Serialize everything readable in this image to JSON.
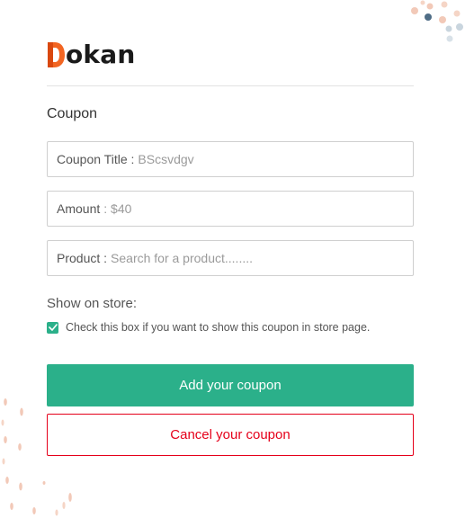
{
  "brand": {
    "letter": "D",
    "name": "okan",
    "accent_color": "#f26522"
  },
  "form": {
    "title": "Coupon",
    "fields": [
      {
        "label": "Coupon Title :",
        "value": "BScsvdgv"
      },
      {
        "label": "Amount",
        "value": ": $40"
      },
      {
        "label": "Product :",
        "value": "Search for a product........"
      }
    ],
    "show_on_store_label": "Show on store:",
    "checkbox_label": "Check this box if you want to show this coupon in store page.",
    "checkbox_checked": true
  },
  "buttons": {
    "add_label": "Add your coupon",
    "cancel_label": "Cancel your coupon"
  },
  "colors": {
    "primary": "#2bb08a",
    "danger": "#e5001a",
    "decor_pink": "#f2c9b8",
    "decor_blue": "#c9d5de"
  }
}
